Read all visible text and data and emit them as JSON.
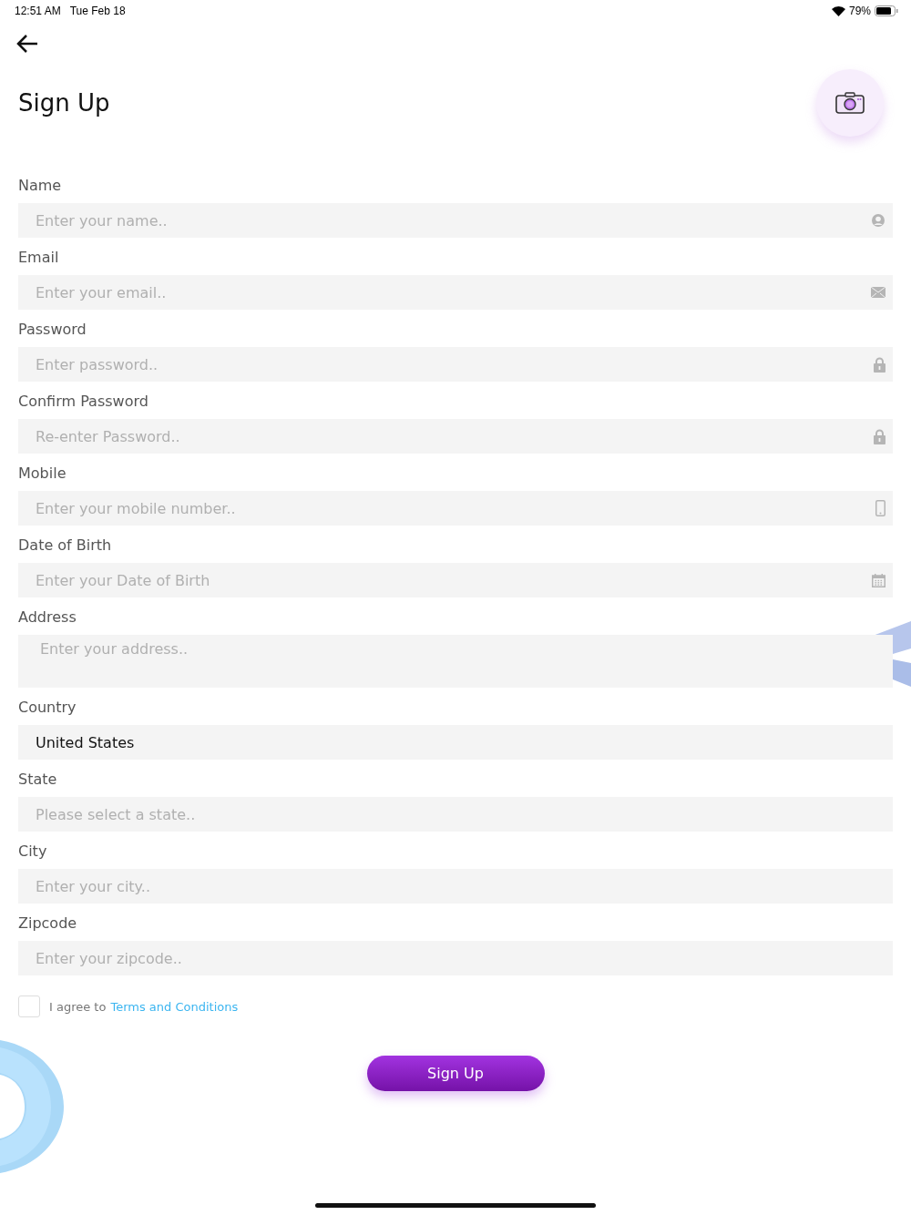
{
  "status_bar": {
    "time": "12:51 AM",
    "date": "Tue Feb 18",
    "battery": "79%"
  },
  "title": "Sign Up",
  "fields": [
    {
      "label": "Name",
      "kind": "input",
      "placeholder": "Enter your name.."
    },
    {
      "label": "Email",
      "kind": "input",
      "placeholder": "Enter your email.."
    },
    {
      "label": "Password",
      "kind": "input",
      "placeholder": "Enter password.."
    },
    {
      "label": "Confirm Password",
      "kind": "input",
      "placeholder": "Re-enter Password.."
    },
    {
      "label": "Mobile",
      "kind": "input",
      "placeholder": "Enter your mobile number.."
    },
    {
      "label": "Date of Birth",
      "kind": "input",
      "placeholder": "Enter your Date of Birth"
    },
    {
      "label": "Address",
      "kind": "textarea",
      "placeholder": "Enter your address.."
    },
    {
      "label": "Country",
      "kind": "input",
      "value": "United States"
    },
    {
      "label": "State",
      "kind": "input",
      "placeholder": "Please select a state.."
    },
    {
      "label": "City",
      "kind": "input",
      "placeholder": "Enter your city.."
    },
    {
      "label": "Zipcode",
      "kind": "input",
      "placeholder": "Enter your zipcode.."
    }
  ],
  "agree": {
    "checked": false,
    "text": "I agree to",
    "link": "Terms and Conditions"
  },
  "submit": "Sign Up"
}
